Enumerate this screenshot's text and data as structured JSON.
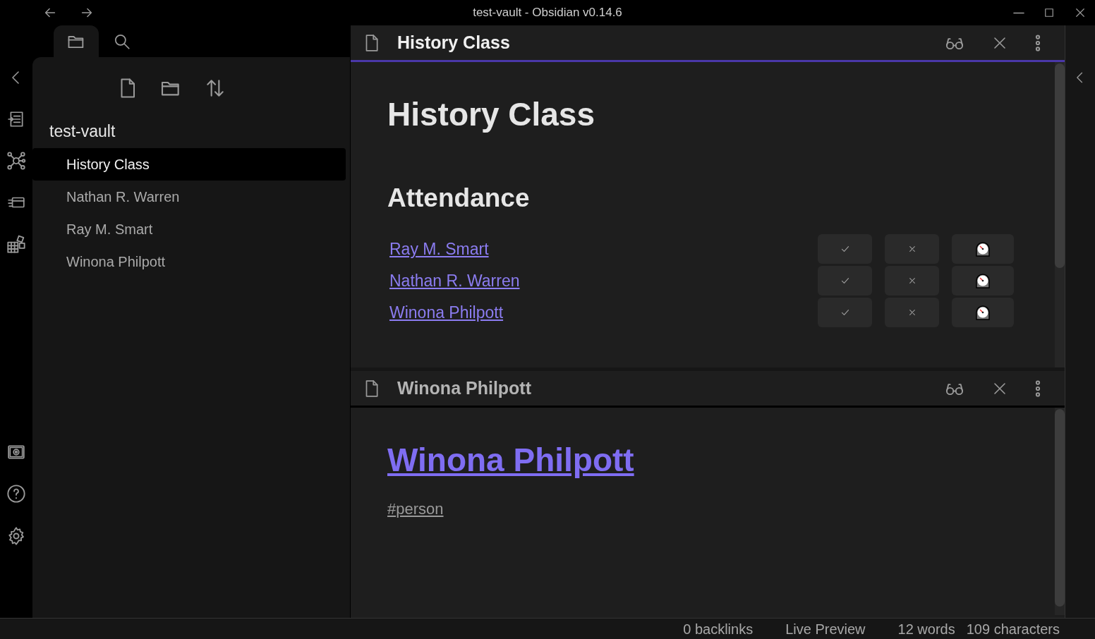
{
  "window": {
    "title": "test-vault - Obsidian v0.14.6"
  },
  "sidebar": {
    "vault_name": "test-vault",
    "files": [
      {
        "label": "History Class",
        "selected": true
      },
      {
        "label": "Nathan R. Warren",
        "selected": false
      },
      {
        "label": "Ray M. Smart",
        "selected": false
      },
      {
        "label": "Winona Philpott",
        "selected": false
      }
    ]
  },
  "panes": [
    {
      "title": "History Class",
      "active": true,
      "heading": "History Class",
      "heading_link": false,
      "section": "Attendance",
      "rows": [
        {
          "name": "Ray M. Smart",
          "buttons": [
            {
              "kind": "present"
            },
            {
              "kind": "absent"
            },
            {
              "kind": "late"
            }
          ]
        },
        {
          "name": "Nathan R. Warren",
          "buttons": [
            {
              "kind": "present"
            },
            {
              "kind": "absent"
            },
            {
              "kind": "late"
            }
          ]
        },
        {
          "name": "Winona Philpott",
          "buttons": [
            {
              "kind": "present"
            },
            {
              "kind": "absent"
            },
            {
              "kind": "late"
            }
          ]
        }
      ]
    },
    {
      "title": "Winona Philpott",
      "active": false,
      "heading": "Winona Philpott",
      "heading_link": true,
      "tag": "#person"
    }
  ],
  "status_bar": [
    "0 backlinks",
    "Live Preview",
    "12 words",
    "109 characters"
  ]
}
